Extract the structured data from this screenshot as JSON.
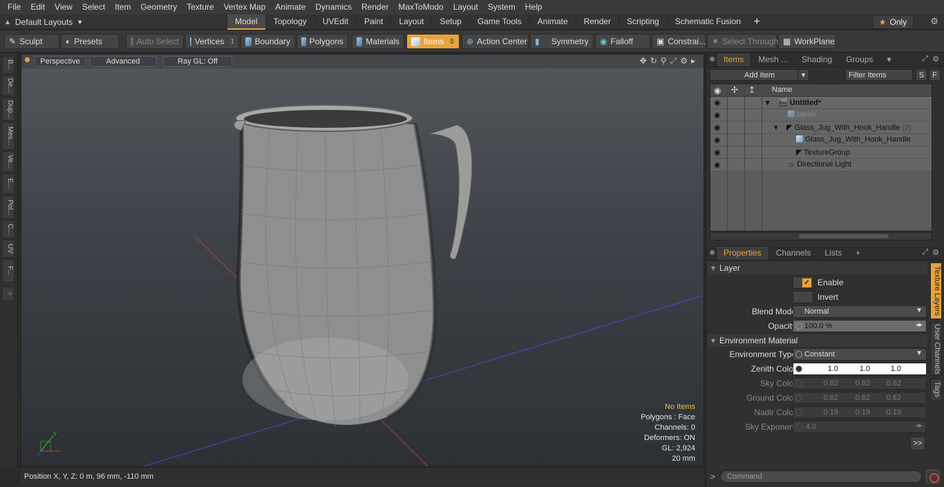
{
  "menubar": [
    "File",
    "Edit",
    "View",
    "Select",
    "Item",
    "Geometry",
    "Texture",
    "Vertex Map",
    "Animate",
    "Dynamics",
    "Render",
    "MaxToModo",
    "Layout",
    "System",
    "Help"
  ],
  "layout_label": "Default Layouts",
  "mode_tabs": [
    "Model",
    "Topology",
    "UVEdit",
    "Paint",
    "Layout",
    "Setup",
    "Game Tools",
    "Animate",
    "Render",
    "Scripting",
    "Schematic Fusion"
  ],
  "only_label": "Only",
  "toolbar": {
    "sculpt": "Sculpt",
    "presets": "Presets",
    "auto_select": "Auto Select",
    "vertices": "Vertices",
    "vertices_count": "1",
    "boundary": "Boundary",
    "polygons": "Polygons",
    "materials": "Materials",
    "items": "Items",
    "items_count": "5",
    "action_center": "Action Center",
    "symmetry": "Symmetry",
    "falloff": "Falloff",
    "constraints": "Constrai...",
    "select_through": "Select Through",
    "workplane": "WorkPlane"
  },
  "left_tabs": [
    "B...",
    "De...",
    "Dup...",
    "Mes...",
    "Ve...",
    "E...",
    "Pol...",
    "C...",
    "UV",
    "F..."
  ],
  "viewport": {
    "perspective": "Perspective",
    "advanced": "Advanced",
    "raygl": "Ray GL: Off",
    "info": {
      "no_items": "No Items",
      "polygons": "Polygons : Face",
      "channels": "Channels: 0",
      "deformers": "Deformers: ON",
      "gl": "GL: 2,924",
      "scale": "20 mm"
    }
  },
  "status": {
    "position": "Position X, Y, Z:  0 m, 96 mm, -110 mm"
  },
  "items_panel": {
    "tabs": [
      "Items",
      "Mesh ...",
      "Shading",
      "Groups"
    ],
    "add_item": "Add Item",
    "filter": "Filter Items",
    "s_btn": "S",
    "f_btn": "F",
    "col_name": "Name",
    "rows": [
      {
        "label": "Untitled*"
      },
      {
        "label": "Mesh"
      },
      {
        "label": "Glass_Jug_With_Hook_Handle",
        "count": "(2)"
      },
      {
        "label": "Glass_Jug_With_Hook_Handle"
      },
      {
        "label": "TextureGroup"
      },
      {
        "label": "Directional Light"
      }
    ]
  },
  "props_panel": {
    "tabs": [
      "Properties",
      "Channels",
      "Lists"
    ],
    "section_layer": "Layer",
    "enable": "Enable",
    "invert": "Invert",
    "blend_mode_label": "Blend Mode",
    "blend_mode": "Normal",
    "opacity_label": "Opacity",
    "opacity": "100.0 %",
    "section_env": "Environment Material",
    "env_type_label": "Environment Type",
    "env_type": "Constant",
    "zenith_label": "Zenith Color",
    "zenith": [
      "1.0",
      "1.0",
      "1.0"
    ],
    "sky_label": "Sky Color",
    "sky": [
      "0.62",
      "0.62",
      "0.62"
    ],
    "ground_label": "Ground Color",
    "ground": [
      "0.62",
      "0.62",
      "0.62"
    ],
    "nadir_label": "Nadir Color",
    "nadir": [
      "0.19",
      "0.19",
      "0.19"
    ],
    "sky_exp_label": "Sky Exponent",
    "sky_exp": "4.0",
    "more": ">>",
    "side_tabs": [
      "Texture Layers",
      "User Channels",
      "Tags"
    ]
  },
  "command_placeholder": "Command"
}
